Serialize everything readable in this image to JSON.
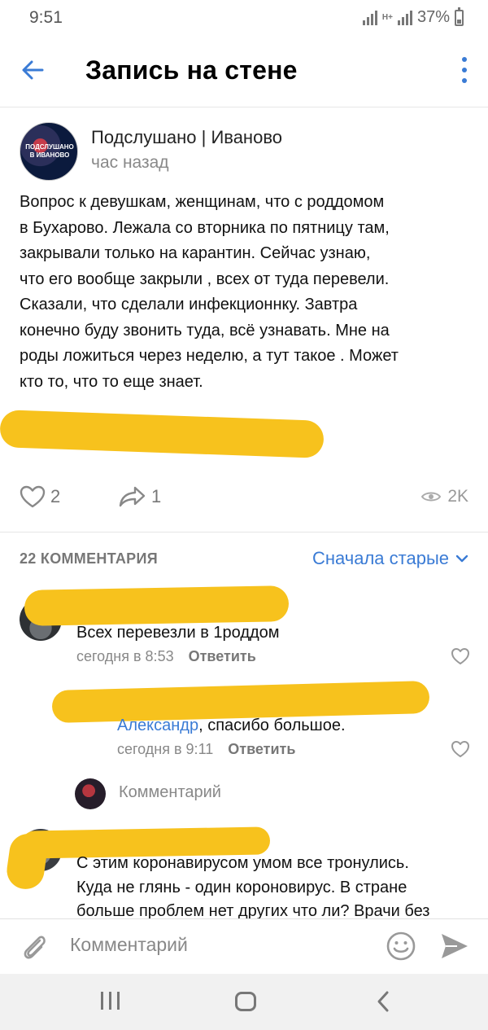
{
  "status_bar": {
    "time": "9:51",
    "network": "H+",
    "battery": "37%"
  },
  "header": {
    "title": "Запись на стене"
  },
  "post": {
    "avatar_text": "ПОДСЛУШАНО В ИВАНОВО",
    "author": "Подслушано | Иваново",
    "time": "час назад",
    "text": "Вопрос к девушкам, женщинам,  что с роддомом\nв Бухарово.   Лежала со вторника по пятницу там,\nзакрывали только на карантин.   Сейчас узнаю,\nчто его вообще закрыли , всех от туда перевели.\nСказали, что сделали инфекционнку.   Завтра\nконечно буду звонить туда, всё узнавать.   Мне на\nроды ложиться через неделю,  а тут такое . Может\nкто то, что то еще знает.",
    "likes": "2",
    "shares": "1",
    "views": "2K"
  },
  "comments_header": {
    "count_label": "22 КОММЕНТАРИЯ",
    "sort_label": "Сначала старые"
  },
  "comments": [
    {
      "text": "Всех перевезли в 1роддом",
      "time": "сегодня в 8:53",
      "reply_label": "Ответить"
    },
    {
      "mention": "Александр",
      "text": ", спасибо большое.",
      "time": "сегодня в 9:11",
      "reply_label": "Ответить"
    },
    {
      "lines": [
        "С этим коронавирусом умом все тронулись.",
        "Куда не глянь - один короновирус. В стране",
        "больше проблем нет других что ли? Врачи без"
      ]
    }
  ],
  "inline_comment": {
    "placeholder": "Комментарий"
  },
  "bottom_bar": {
    "placeholder": "Комментарий"
  },
  "colors": {
    "accent": "#3a7bd5",
    "scribble": "#f7c21d"
  }
}
